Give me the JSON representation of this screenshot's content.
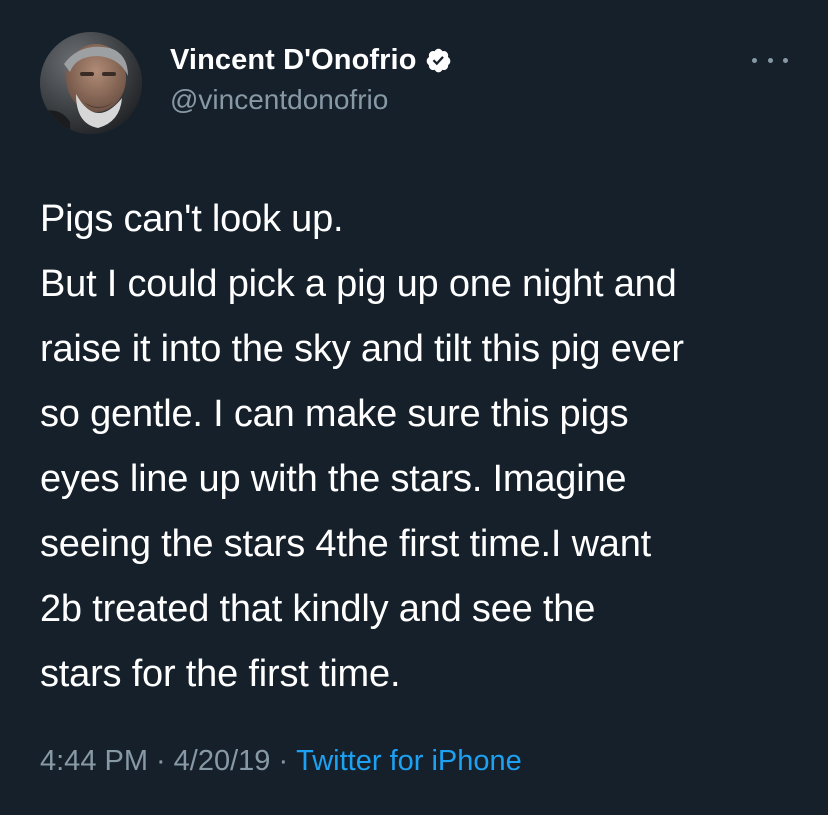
{
  "author": {
    "display_name": "Vincent D'Onofrio",
    "handle": "@vincentdonofrio",
    "verified": true
  },
  "tweet": {
    "lines": [
      "Pigs can't look up.",
      "But I could pick a pig up one night and",
      "raise it into the sky and tilt this pig ever",
      "so gentle. I can make sure this pigs",
      "eyes line up with the stars. Imagine",
      "seeing the stars 4the first time.I want",
      "2b treated that kindly and see the",
      "stars for the first time."
    ]
  },
  "meta": {
    "time": "4:44 PM",
    "separator": "·",
    "date": "4/20/19",
    "source": "Twitter for iPhone"
  },
  "icons": {
    "verified": "verified-badge-icon",
    "more": "more-options-icon",
    "avatar": "profile-avatar"
  },
  "colors": {
    "background": "#15202b",
    "primary_text": "#ffffff",
    "secondary_text": "#8899a6",
    "link": "#1da1f2"
  }
}
